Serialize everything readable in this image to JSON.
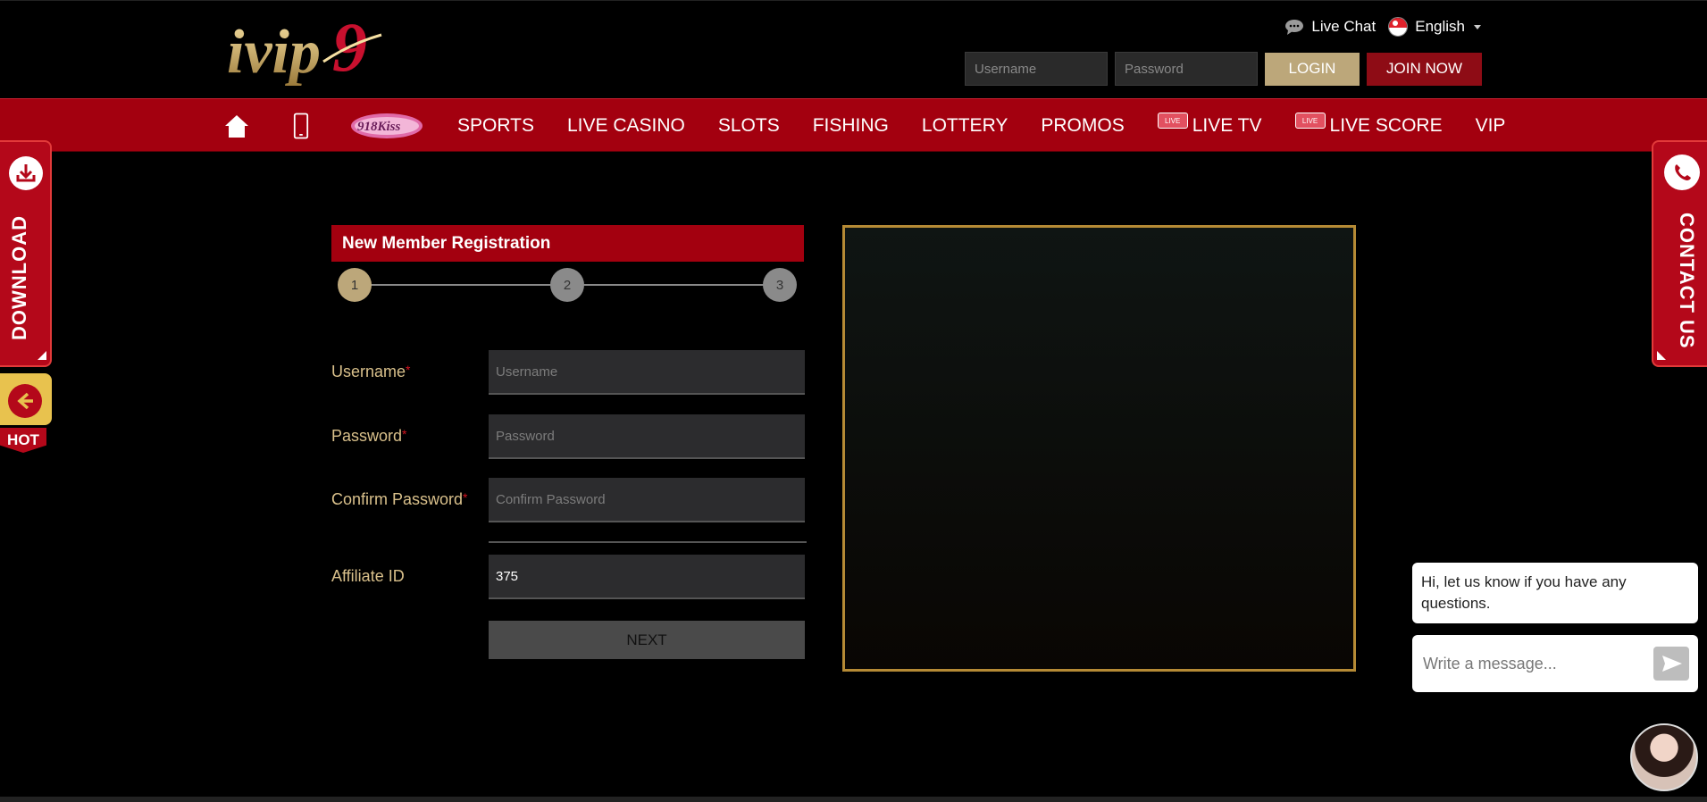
{
  "brand": {
    "logo_text": "ivip9"
  },
  "header": {
    "live_chat": "Live Chat",
    "language": "English",
    "username_placeholder": "Username",
    "password_placeholder": "Password",
    "login_label": "LOGIN",
    "join_label": "JOIN NOW"
  },
  "nav": {
    "badge_918": "918Kiss",
    "items": [
      "SPORTS",
      "LIVE CASINO",
      "SLOTS",
      "FISHING",
      "LOTTERY",
      "PROMOS",
      "LIVE TV",
      "LIVE SCORE",
      "VIP"
    ],
    "live_badge": "LIVE"
  },
  "side": {
    "download": "DOWNLOAD",
    "hot": "HOT",
    "contact": "CONTACT US"
  },
  "registration": {
    "title": "New Member Registration",
    "steps": [
      "1",
      "2",
      "3"
    ],
    "fields": {
      "username_label": "Username",
      "username_placeholder": "Username",
      "password_label": "Password",
      "password_placeholder": "Password",
      "confirm_label": "Confirm Password",
      "confirm_placeholder": "Confirm Password",
      "affiliate_label": "Affiliate ID",
      "affiliate_value": "375"
    },
    "required_mark": "*",
    "next_label": "NEXT"
  },
  "chat": {
    "greeting": "Hi, let us know if you have any questions.",
    "input_placeholder": "Write a message..."
  },
  "colors": {
    "nav_red": "#a3000f",
    "gold": "#bca77a",
    "label_gold": "#d9c08b",
    "frame_gold": "#b58a35"
  }
}
